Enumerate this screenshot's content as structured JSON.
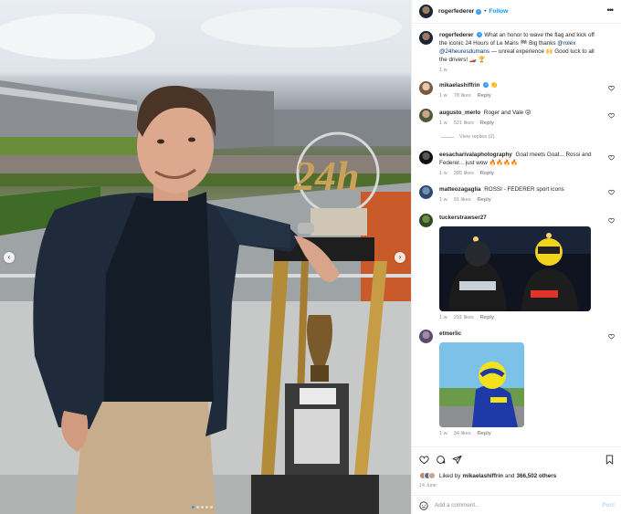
{
  "post": {
    "author": "rogerfederer",
    "follow_label": "Follow",
    "separator": "•",
    "caption": {
      "user": "rogerfederer",
      "text_a": "What an honor to wave the flag and kick off the iconic 24 Hours of Le Mans 🏁 Big thanks ",
      "mention_a": "@rolex",
      "text_b": " ",
      "mention_b": "@24heuresdumans",
      "text_c": " — unreal experience 🙌 Good luck to all the drivers! 🏎️ 🏆",
      "time": "1 w"
    },
    "photo_badge_text": "24h"
  },
  "comments": [
    {
      "user": "mikaelashiffrin",
      "verified": true,
      "text": "👏",
      "time": "1 w",
      "likes": "78 likes",
      "reply": "Reply"
    },
    {
      "user": "augusto_merlo",
      "verified": false,
      "text": "Roger and Vale 😝",
      "time": "1 w",
      "likes": "521 likes",
      "reply": "Reply",
      "view_replies": "View replies (2)"
    },
    {
      "user": "eesacharivalaphotography",
      "verified": false,
      "text": "Goat meets Goat... Rossi and Federer... just wow 🔥🔥🔥🔥",
      "time": "1 w",
      "likes": "385 likes",
      "reply": "Reply"
    },
    {
      "user": "matteozagaglia",
      "verified": false,
      "text": "ROSSI - FEDERER sport icons",
      "time": "1 w",
      "likes": "91 likes",
      "reply": "Reply"
    },
    {
      "user": "tuckerstrawser27",
      "verified": false,
      "text": "",
      "time": "1 w",
      "likes": "291 likes",
      "reply": "Reply"
    },
    {
      "user": "etmerlic",
      "verified": false,
      "text": "",
      "time": "1 w",
      "likes": "34 likes",
      "reply": "Reply"
    }
  ],
  "footer": {
    "liked_by_prefix": "Liked by",
    "liked_by_user": "mikaelashiffrin",
    "liked_by_and": "and",
    "liked_by_count": "366,502 others",
    "date": "14 June",
    "add_comment_placeholder": "Add a comment...",
    "post_label": "Post"
  },
  "colors": {
    "accent": "#0095f6",
    "verified": "#3897f0",
    "muted": "#8e8e8e",
    "link": "#00376b"
  },
  "icons": [
    "more-icon",
    "heart-icon",
    "comment-icon",
    "share-icon",
    "bookmark-icon",
    "emoji-icon",
    "chevron-left-icon",
    "chevron-right-icon"
  ]
}
